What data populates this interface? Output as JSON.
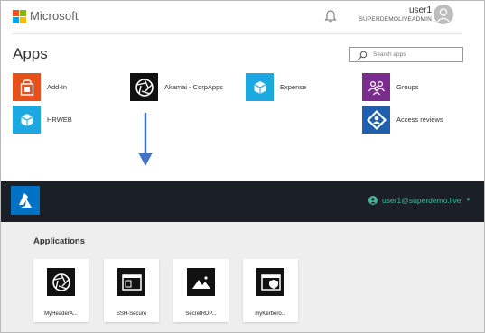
{
  "brand": {
    "name": "Microsoft",
    "colors": [
      "#f25022",
      "#7fba00",
      "#00a4ef",
      "#ffb900"
    ]
  },
  "header": {
    "notification_icon": "bell-icon",
    "user_name": "user1",
    "tenant": "SUPERDEMOLIVEADMIN",
    "avatar_icon": "person-icon"
  },
  "apps_section": {
    "title": "Apps",
    "search_placeholder": "Search apps",
    "tiles": [
      {
        "label": "Add-In",
        "icon": "office-icon",
        "color": "#e74f1b"
      },
      {
        "label": "Akamai - CorpApps",
        "icon": "aperture-icon",
        "color": "#111111"
      },
      {
        "label": "Expense",
        "icon": "cube-icon",
        "color": "#1ca8e0"
      },
      {
        "label": "Groups",
        "icon": "groups-icon",
        "color": "#7b2d8e"
      },
      {
        "label": "HRWEB",
        "icon": "cube-icon",
        "color": "#1ca8e0"
      },
      {
        "label": "Access reviews",
        "icon": "access-reviews-icon",
        "color": "#1f5fae"
      }
    ]
  },
  "transition": {
    "icon": "arrow-down-icon",
    "color": "#4472c4"
  },
  "portal": {
    "logo_icon": "azure-logo-icon",
    "user_label": "user1@superdemo.live",
    "accent": "#43b79c",
    "bar_color": "#1b2027",
    "section_title": "Applications",
    "apps": [
      {
        "label": "MyHeaderA...",
        "icon": "aperture-icon"
      },
      {
        "label": "SSH-Secure",
        "icon": "terminal-window-icon"
      },
      {
        "label": "SecretRDP...",
        "icon": "mountains-image-icon"
      },
      {
        "label": "myKerbero...",
        "icon": "shield-window-icon"
      }
    ]
  }
}
